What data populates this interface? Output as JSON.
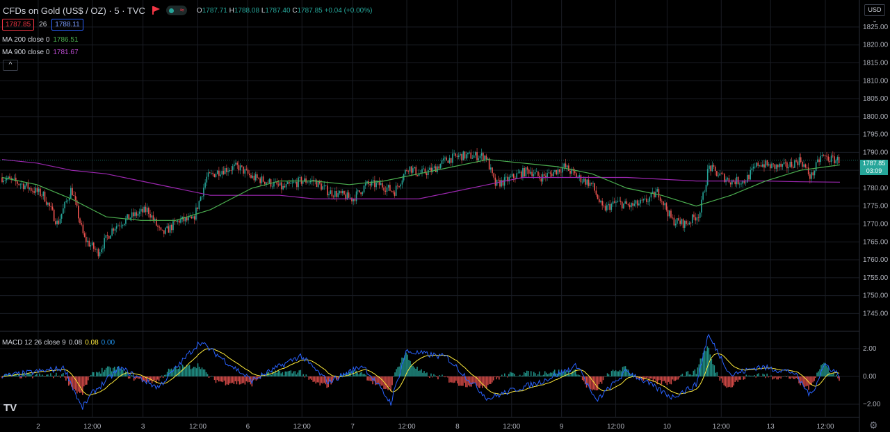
{
  "header": {
    "symbol": "CFDs on Gold (US$ / OZ) · 5 · TVC",
    "open_label": "O",
    "open": "1787.71",
    "high_label": "H",
    "high": "1788.08",
    "low_label": "L",
    "low": "1787.40",
    "close_label": "C",
    "close": "1787.85",
    "change": "+0.04 (+0.00%)",
    "market_status_icon": "market-status-icon",
    "wave_icon": "≈"
  },
  "quote": {
    "bid": "1787.85",
    "spread": "26",
    "ask": "1788.11"
  },
  "indicators": {
    "ma200": {
      "label": "MA 200 close 0",
      "value": "1786.51",
      "color": "#4caf50"
    },
    "ma900": {
      "label": "MA 900 close 0",
      "value": "1781.67",
      "color": "#9c27b0"
    },
    "collapse_label": "^"
  },
  "macd": {
    "label": "MACD 12 26 close 9",
    "macd": "0.08",
    "signal": "0.08",
    "hist": "0.00",
    "macd_color": "#d1d4dc",
    "signal_color": "#ffeb3b",
    "hist_color": "#2196f3"
  },
  "currency": "USD ⌄",
  "last_price": {
    "price": "1787.85",
    "countdown": "03:09",
    "color": "#26a69a"
  },
  "logo": "TV",
  "colors": {
    "up": "#26a69a",
    "down": "#ef5350",
    "ma200": "#4caf50",
    "ma900": "#9c27b0",
    "macd": "#2962ff",
    "signal": "#ffeb3b"
  },
  "chart_data": [
    {
      "type": "candlestick",
      "title": "",
      "ylim": [
        1741,
        1831
      ],
      "yticks": [
        1745,
        1750,
        1755,
        1760,
        1765,
        1770,
        1775,
        1780,
        1785,
        1790,
        1795,
        1800,
        1805,
        1810,
        1815,
        1820,
        1825
      ],
      "ytick_labels": [
        "1745.00",
        "1750.00",
        "1755.00",
        "1760.00",
        "1765.00",
        "1770.00",
        "1775.00",
        "1780.00",
        "1785.00",
        "1790.00",
        "1795.00",
        "1800.00",
        "1805.00",
        "1810.00",
        "1815.00",
        "1820.00",
        "1825.00"
      ],
      "x_index_range": [
        0,
        1200
      ],
      "x_tick_index": [
        52,
        130,
        203,
        282,
        354,
        432,
        505,
        583,
        656,
        734,
        806,
        884,
        958,
        1036,
        1107,
        1186
      ],
      "x_tick_labels": [
        "2",
        "12:00",
        "3",
        "12:00",
        "6",
        "12:00",
        "7",
        "12:00",
        "8",
        "12:00",
        "9",
        "12:00",
        "10",
        "12:00",
        "13",
        "12:00"
      ],
      "close_path": [
        [
          0,
          1783
        ],
        [
          30,
          1781
        ],
        [
          60,
          1778
        ],
        [
          80,
          1770
        ],
        [
          100,
          1780
        ],
        [
          118,
          1766
        ],
        [
          138,
          1762
        ],
        [
          160,
          1769
        ],
        [
          185,
          1772
        ],
        [
          210,
          1774
        ],
        [
          230,
          1767
        ],
        [
          255,
          1771
        ],
        [
          275,
          1771
        ],
        [
          295,
          1783
        ],
        [
          315,
          1785
        ],
        [
          340,
          1786
        ],
        [
          360,
          1783
        ],
        [
          380,
          1782
        ],
        [
          405,
          1780
        ],
        [
          430,
          1782
        ],
        [
          450,
          1782
        ],
        [
          470,
          1779
        ],
        [
          490,
          1778
        ],
        [
          505,
          1777
        ],
        [
          525,
          1781
        ],
        [
          545,
          1781
        ],
        [
          565,
          1779
        ],
        [
          585,
          1786
        ],
        [
          600,
          1784
        ],
        [
          620,
          1785
        ],
        [
          640,
          1788
        ],
        [
          660,
          1789
        ],
        [
          680,
          1789
        ],
        [
          697,
          1789
        ],
        [
          710,
          1781
        ],
        [
          725,
          1782
        ],
        [
          745,
          1784
        ],
        [
          760,
          1785
        ],
        [
          775,
          1783
        ],
        [
          790,
          1784
        ],
        [
          810,
          1786
        ],
        [
          830,
          1783
        ],
        [
          850,
          1781
        ],
        [
          865,
          1774
        ],
        [
          885,
          1776
        ],
        [
          905,
          1775
        ],
        [
          925,
          1776
        ],
        [
          945,
          1779
        ],
        [
          965,
          1771
        ],
        [
          985,
          1770
        ],
        [
          1005,
          1773
        ],
        [
          1018,
          1786
        ],
        [
          1030,
          1784
        ],
        [
          1050,
          1782
        ],
        [
          1070,
          1782
        ],
        [
          1090,
          1787
        ],
        [
          1110,
          1786
        ],
        [
          1130,
          1786
        ],
        [
          1150,
          1788
        ],
        [
          1165,
          1783
        ],
        [
          1180,
          1789
        ],
        [
          1195,
          1788
        ],
        [
          1207,
          1787.85
        ]
      ],
      "ma200": [
        [
          0,
          1783
        ],
        [
          50,
          1781
        ],
        [
          100,
          1777
        ],
        [
          150,
          1772
        ],
        [
          200,
          1771
        ],
        [
          250,
          1771
        ],
        [
          300,
          1774
        ],
        [
          330,
          1777
        ],
        [
          360,
          1780
        ],
        [
          400,
          1782
        ],
        [
          450,
          1782
        ],
        [
          500,
          1781
        ],
        [
          550,
          1782
        ],
        [
          600,
          1784
        ],
        [
          650,
          1786
        ],
        [
          700,
          1788
        ],
        [
          750,
          1787
        ],
        [
          800,
          1786
        ],
        [
          850,
          1784
        ],
        [
          900,
          1780
        ],
        [
          950,
          1778
        ],
        [
          1000,
          1775
        ],
        [
          1050,
          1778
        ],
        [
          1100,
          1782
        ],
        [
          1150,
          1785
        ],
        [
          1207,
          1786.51
        ]
      ],
      "ma900": [
        [
          0,
          1788
        ],
        [
          50,
          1787
        ],
        [
          100,
          1785
        ],
        [
          150,
          1784
        ],
        [
          200,
          1782
        ],
        [
          250,
          1780
        ],
        [
          300,
          1778
        ],
        [
          350,
          1778
        ],
        [
          400,
          1778
        ],
        [
          450,
          1777
        ],
        [
          500,
          1777
        ],
        [
          550,
          1777
        ],
        [
          600,
          1777
        ],
        [
          650,
          1779
        ],
        [
          700,
          1781
        ],
        [
          750,
          1783
        ],
        [
          800,
          1783
        ],
        [
          850,
          1783
        ],
        [
          900,
          1783
        ],
        [
          950,
          1782.5
        ],
        [
          1000,
          1782
        ],
        [
          1050,
          1782
        ],
        [
          1100,
          1782
        ],
        [
          1150,
          1781.8
        ],
        [
          1207,
          1781.67
        ]
      ],
      "last_price": 1787.85
    },
    {
      "type": "line",
      "title": "MACD 12 26 close 9",
      "ylim": [
        -2.8,
        3.2
      ],
      "yticks": [
        2.0,
        0.0,
        -2.0
      ],
      "ytick_labels": [
        "2.00",
        "0.00",
        "−2.00"
      ],
      "macd_spikes": [
        [
          0,
          0
        ],
        [
          90,
          0.6
        ],
        [
          115,
          -2.3
        ],
        [
          130,
          -1.2
        ],
        [
          170,
          0.6
        ],
        [
          225,
          -0.8
        ],
        [
          285,
          2.5
        ],
        [
          330,
          0.8
        ],
        [
          360,
          -0.3
        ],
        [
          430,
          1.5
        ],
        [
          470,
          -0.4
        ],
        [
          520,
          0.8
        ],
        [
          560,
          -1.9
        ],
        [
          582,
          1.8
        ],
        [
          640,
          1.4
        ],
        [
          700,
          -1.6
        ],
        [
          735,
          -1.0
        ],
        [
          775,
          -0.4
        ],
        [
          830,
          0.8
        ],
        [
          855,
          -1.8
        ],
        [
          900,
          0.4
        ],
        [
          965,
          -1.5
        ],
        [
          1000,
          -0.6
        ],
        [
          1017,
          3.0
        ],
        [
          1050,
          0.1
        ],
        [
          1090,
          0.7
        ],
        [
          1115,
          0.5
        ],
        [
          1140,
          0.3
        ],
        [
          1165,
          -1.4
        ],
        [
          1185,
          0.9
        ],
        [
          1207,
          0.08
        ]
      ]
    }
  ]
}
